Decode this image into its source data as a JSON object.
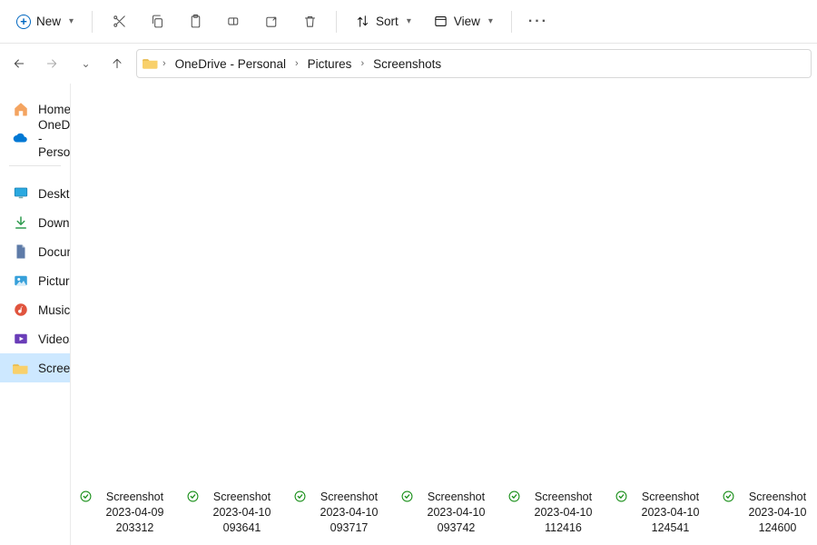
{
  "toolbar": {
    "new_label": "New",
    "sort_label": "Sort",
    "view_label": "View"
  },
  "breadcrumb": {
    "parts": [
      "OneDrive - Personal",
      "Pictures",
      "Screenshots"
    ]
  },
  "sidebar": {
    "top": [
      {
        "label": "Home",
        "icon": "home"
      },
      {
        "label": "OneDrive - Persona",
        "icon": "onedrive"
      }
    ],
    "quick": [
      {
        "label": "Desktop",
        "icon": "desktop",
        "pinned": true
      },
      {
        "label": "Downloads",
        "icon": "downloads",
        "pinned": true
      },
      {
        "label": "Documents",
        "icon": "documents",
        "pinned": true
      },
      {
        "label": "Pictures",
        "icon": "pictures",
        "pinned": true
      },
      {
        "label": "Music",
        "icon": "music",
        "pinned": true
      },
      {
        "label": "Videos",
        "icon": "videos",
        "pinned": true
      },
      {
        "label": "Screenshots",
        "icon": "folder",
        "pinned": false,
        "active": true
      }
    ]
  },
  "files": [
    {
      "name": "Screenshot 2023-04-09 203312",
      "synced": true
    },
    {
      "name": "Screenshot 2023-04-10 093641",
      "synced": true
    },
    {
      "name": "Screenshot 2023-04-10 093717",
      "synced": true
    },
    {
      "name": "Screenshot 2023-04-10 093742",
      "synced": true
    },
    {
      "name": "Screenshot 2023-04-10 112416",
      "synced": true
    },
    {
      "name": "Screenshot 2023-04-10 124541",
      "synced": true
    },
    {
      "name": "Screenshot 2023-04-10 124600",
      "synced": true
    }
  ]
}
